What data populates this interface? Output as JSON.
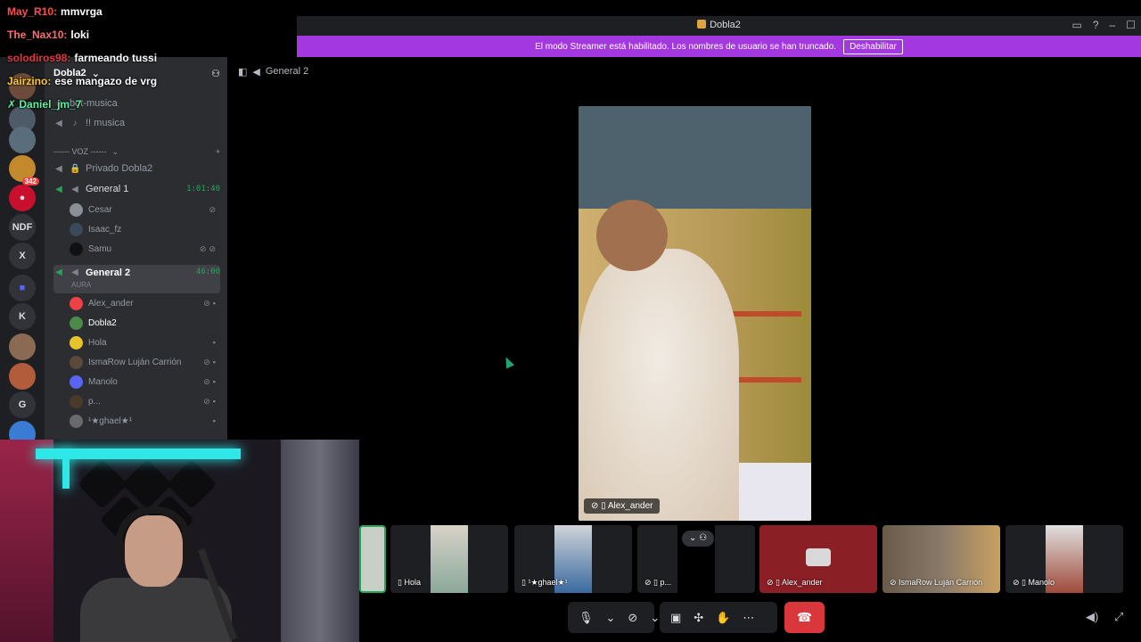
{
  "window": {
    "title": "Dobla2"
  },
  "banner": {
    "text": "El modo Streamer está habilitado. Los nombres de usuario se han truncado.",
    "button": "Deshabilitar",
    "color": "#a338e0"
  },
  "chat": [
    {
      "name": "May_R10:",
      "text": "mmvrga",
      "color": "#ff4d4d"
    },
    {
      "name": "The_Nax10:",
      "text": "loki",
      "color": "#ff6b6b"
    },
    {
      "name": "solodiros98:",
      "text": "farmeando tussi",
      "color": "#e0383e"
    },
    {
      "name": "Jairzino:",
      "text": "ese mangazo de vrg",
      "color": "#ffcc33"
    },
    {
      "name": "Daniel_jm_7",
      "text": "",
      "color": "#5df2a0"
    }
  ],
  "rail": {
    "items": [
      "NDF",
      "X",
      "K",
      "G"
    ],
    "badges": [
      "342"
    ]
  },
  "sidebar": {
    "server": "Dobla2",
    "channels": [
      {
        "label": "bot-musica"
      },
      {
        "label": "!! musica"
      }
    ],
    "voice_header": "------ VOZ ------",
    "voice": [
      {
        "label": "Privado Dobla2",
        "time": ""
      },
      {
        "label": "General 1",
        "time": "1:01:40",
        "users": [
          "Cesar",
          "Isaac_fz",
          "Samu"
        ]
      },
      {
        "label": "General 2",
        "time": "46:00",
        "sub": "AURA",
        "users": [
          "Alex_ander",
          "Dobla2",
          "Hola",
          "IsmaRow Luján Carrión",
          "Manolo",
          "p...",
          "¹★ghael★¹"
        ]
      }
    ]
  },
  "main": {
    "channel": "General 2",
    "focused_label": "Alex_ander",
    "tiles": [
      "Hola",
      "¹★ghael★¹",
      "p...",
      "Alex_ander",
      "IsmaRow Luján Carrión",
      "Manolo"
    ]
  },
  "colors": {
    "accent": "#5865f2",
    "hangup": "#da373c",
    "online": "#23a55a"
  }
}
